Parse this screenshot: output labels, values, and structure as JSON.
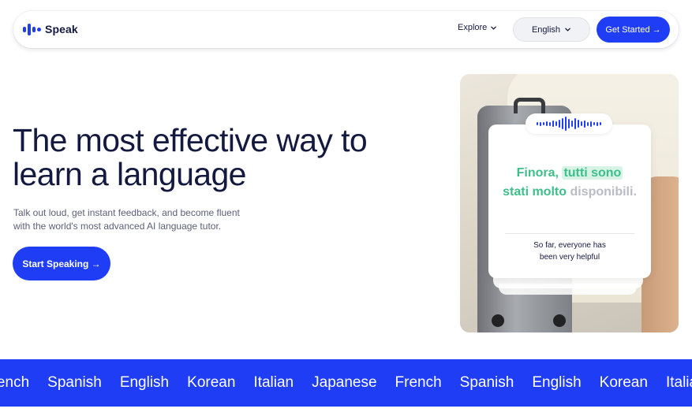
{
  "nav": {
    "brand": "Speak",
    "explore_label": "Explore",
    "language_label": "English",
    "get_started_label": "Get Started →"
  },
  "hero": {
    "title_line1": "The most effective way to",
    "title_line2": "learn a language",
    "subtitle_line1": "Talk out loud, get instant feedback, and become fluent",
    "subtitle_line2": "with the world's most advanced AI language tutor.",
    "cta_label": "Start Speaking →"
  },
  "card": {
    "italian_part1": "Finora,",
    "italian_highlight": "tutti sono",
    "italian_part3": "stati molto",
    "italian_muted": "disponibili.",
    "english_line1": "So far, everyone has",
    "english_line2": "been very helpful"
  },
  "marquee": {
    "languages": [
      "French",
      "Spanish",
      "English",
      "Korean",
      "Italian",
      "Japanese",
      "French",
      "Spanish",
      "English",
      "Korean",
      "Italian"
    ]
  },
  "colors": {
    "brand_blue": "#1f3df5",
    "navy_text": "#14193f",
    "italian_green": "#3dbf8a"
  }
}
